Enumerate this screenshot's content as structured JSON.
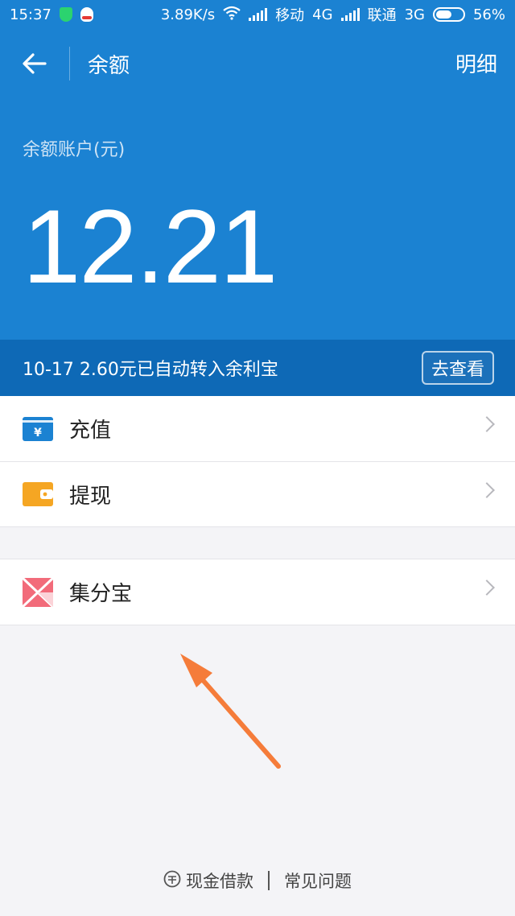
{
  "status_bar": {
    "time": "15:37",
    "speed": "3.89K/s",
    "carrier1": "移动",
    "network1": "4G",
    "carrier2": "联通",
    "network2": "3G",
    "battery": "56%"
  },
  "nav": {
    "title": "余额",
    "detail_label": "明细"
  },
  "balance": {
    "label": "余额账户(元)",
    "amount": "12.21"
  },
  "notice": {
    "text": "10-17 2.60元已自动转入余利宝",
    "button_label": "去查看"
  },
  "menu": {
    "recharge": "充值",
    "withdraw": "提现",
    "jifenbao": "集分宝"
  },
  "footer": {
    "loan": "现金借款",
    "faq": "常见问题"
  },
  "colors": {
    "primary": "#1b82d2",
    "notice_bg": "#0e69b6",
    "recharge_icon": "#1b82d2",
    "withdraw_icon": "#f5a623",
    "jifenbao_icon": "#f26b7a",
    "annotation_arrow": "#f57c3a"
  }
}
